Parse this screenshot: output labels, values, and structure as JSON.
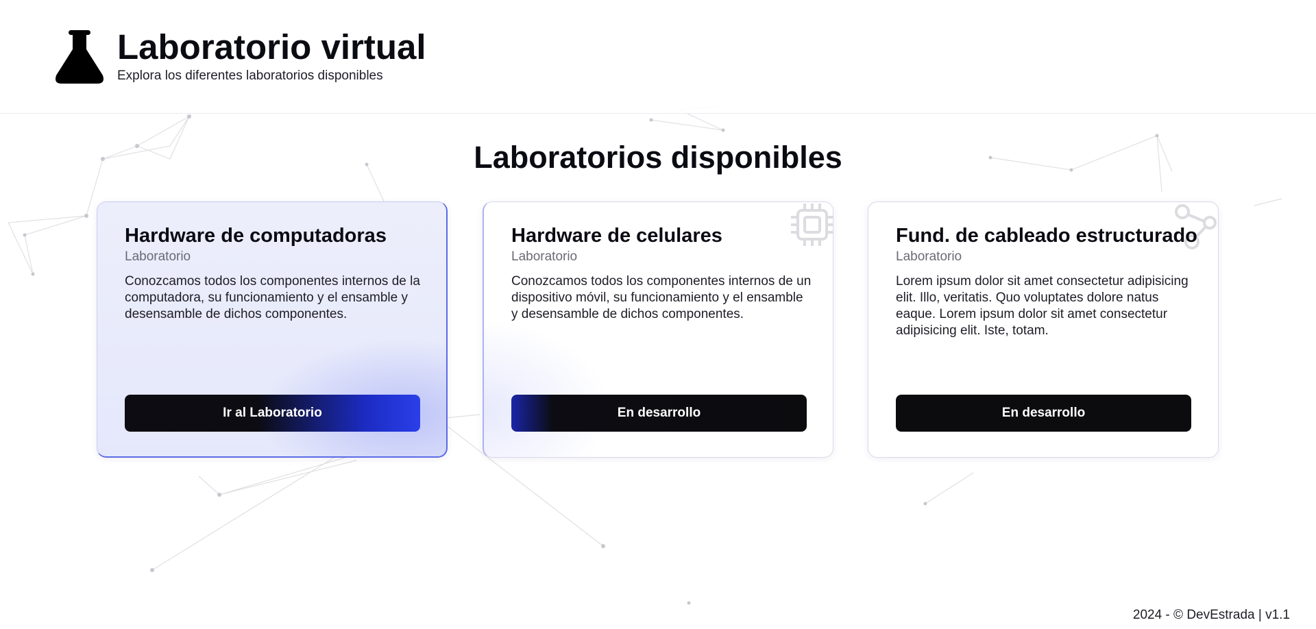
{
  "header": {
    "title": "Laboratorio virtual",
    "subtitle": "Explora los diferentes laboratorios disponibles",
    "logo_icon": "flask-icon"
  },
  "main": {
    "section_title": "Laboratorios disponibles",
    "cards": [
      {
        "title": "Hardware de computadoras",
        "type": "Laboratorio",
        "description": "Conozcamos todos los componentes internos de la computadora, su funcionamiento y el ensamble y desensamble de dichos componentes.",
        "button_label": "Ir al Laboratorio"
      },
      {
        "title": "Hardware de celulares",
        "type": "Laboratorio",
        "description": "Conozcamos todos los componentes internos de un dispositivo móvil, su funcionamiento y el ensamble y desensamble de dichos componentes.",
        "button_label": "En desarrollo",
        "decor_icon": "chip-icon"
      },
      {
        "title": "Fund. de cableado estructurado",
        "type": "Laboratorio",
        "description": "Lorem ipsum dolor sit amet consectetur adipisicing elit. Illo, veritatis. Quo voluptates dolore natus eaque. Lorem ipsum dolor sit amet consectetur adipisicing elit. Iste, totam.",
        "button_label": "En desarrollo",
        "decor_icon": "network-icon"
      }
    ]
  },
  "footer": {
    "text": "2024 - © DevEstrada | v1.1"
  },
  "colors": {
    "button_dark": "#0c0c0f",
    "accent_blue": "#2a3fe8",
    "card_active_bg": "#eceefb"
  }
}
